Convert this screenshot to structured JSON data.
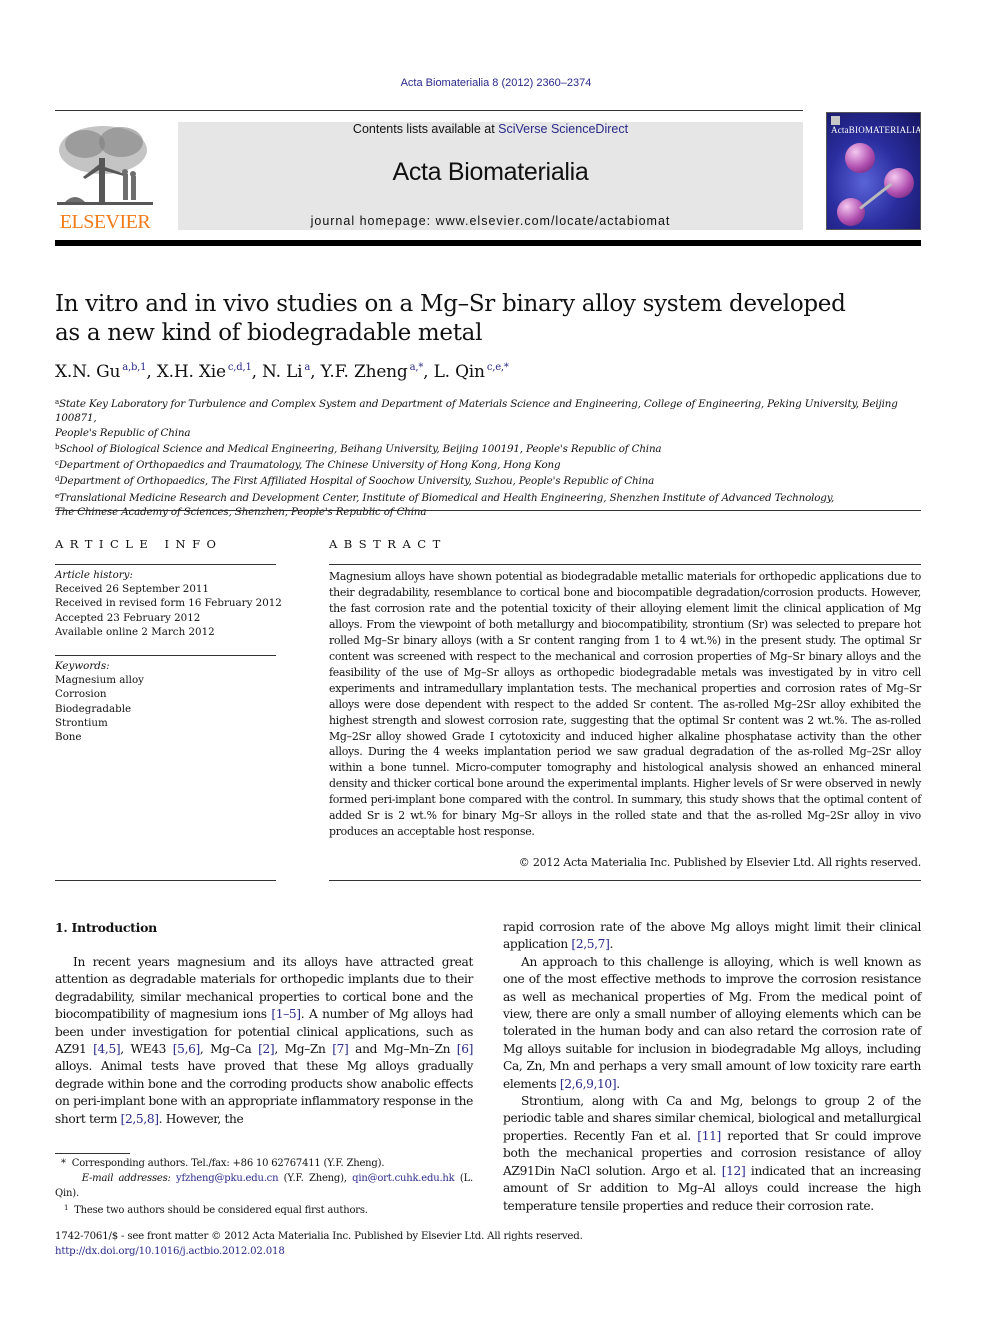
{
  "running_header": "Acta Biomaterialia 8 (2012) 2360–2374",
  "banner": {
    "contents_prefix": "Contents lists available at ",
    "contents_link": "SciVerse ScienceDirect",
    "journal_title": "Acta Biomaterialia",
    "homepage": "journal homepage: www.elsevier.com/locate/actabiomat"
  },
  "publisher_logo": {
    "wordmark": "ELSEVIER",
    "color": "#f07d1a"
  },
  "cover": {
    "title": "ActaBIOMATERIALIA"
  },
  "article": {
    "title_line1": "In vitro and in vivo studies on a Mg–Sr binary alloy system developed",
    "title_line2": "as a new kind of biodegradable metal",
    "authors": [
      {
        "name": "X.N. Gu",
        "sup": "a,b,1",
        "sep": ", "
      },
      {
        "name": "X.H. Xie",
        "sup": "c,d,1",
        "sep": ", "
      },
      {
        "name": "N. Li",
        "sup": "a",
        "sep": ", "
      },
      {
        "name": "Y.F. Zheng",
        "sup": "a,*",
        "sep": ", "
      },
      {
        "name": "L. Qin",
        "sup": "c,e,*",
        "sep": ""
      }
    ],
    "affiliations": [
      {
        "key": "a",
        "line1": "State Key Laboratory for Turbulence and Complex System and Department of Materials Science and Engineering, College of Engineering, Peking University, Beijing 100871,",
        "line2": "People's Republic of China"
      },
      {
        "key": "b",
        "line1": "School of Biological Science and Medical Engineering, Beihang University, Beijing 100191, People's Republic of China",
        "line2": ""
      },
      {
        "key": "c",
        "line1": "Department of Orthopaedics and Traumatology, The Chinese University of Hong Kong, Hong Kong",
        "line2": ""
      },
      {
        "key": "d",
        "line1": "Department of Orthopaedics, The First Affiliated Hospital of Soochow University, Suzhou, People's Republic of China",
        "line2": ""
      },
      {
        "key": "e",
        "line1": "Translational Medicine Research and Development Center, Institute of Biomedical and Health Engineering, Shenzhen Institute of Advanced Technology,",
        "line2": "The Chinese Academy of Sciences, Shenzhen, People's Republic of China"
      }
    ]
  },
  "article_info": {
    "heading": "ARTICLE INFO",
    "history_label": "Article history:",
    "history": [
      "Received 26 September 2011",
      "Received in revised form 16 February 2012",
      "Accepted 23 February 2012",
      "Available online 2 March 2012"
    ],
    "keywords_label": "Keywords:",
    "keywords": [
      "Magnesium alloy",
      "Corrosion",
      "Biodegradable",
      "Strontium",
      "Bone"
    ]
  },
  "abstract": {
    "heading": "ABSTRACT",
    "text": "Magnesium alloys have shown potential as biodegradable metallic materials for orthopedic applications due to their degradability, resemblance to cortical bone and biocompatible degradation/corrosion products. However, the fast corrosion rate and the potential toxicity of their alloying element limit the clinical application of Mg alloys. From the viewpoint of both metallurgy and biocompatibility, strontium (Sr) was selected to prepare hot rolled Mg–Sr binary alloys (with a Sr content ranging from 1 to 4 wt.%) in the present study. The optimal Sr content was screened with respect to the mechanical and corrosion properties of Mg–Sr binary alloys and the feasibility of the use of Mg–Sr alloys as orthopedic biodegradable metals was investigated by in vitro cell experiments and intramedullary implantation tests. The mechanical properties and corrosion rates of Mg–Sr alloys were dose dependent with respect to the added Sr content. The as-rolled Mg–2Sr alloy exhibited the highest strength and slowest corrosion rate, suggesting that the optimal Sr content was 2 wt.%. The as-rolled Mg–2Sr alloy showed Grade I cytotoxicity and induced higher alkaline phosphatase activity than the other alloys. During the 4 weeks implantation period we saw gradual degradation of the as-rolled Mg–2Sr alloy within a bone tunnel. Micro-computer tomography and histological analysis showed an enhanced mineral density and thicker cortical bone around the experimental implants. Higher levels of Sr were observed in newly formed peri-implant bone compared with the control. In summary, this study shows that the optimal content of added Sr is 2 wt.% for binary Mg–Sr alloys in the rolled state and that the as-rolled Mg–2Sr alloy in vivo produces an acceptable host response.",
    "copyright": "© 2012 Acta Materialia Inc. Published by Elsevier Ltd. All rights reserved."
  },
  "introduction": {
    "heading": "1. Introduction",
    "left_paragraph": [
      {
        "t": "In recent years magnesium and its alloys have attracted great attention as degradable materials for orthopedic implants due to their degradability, similar mechanical properties to cortical bone and the biocompatibility of magnesium ions "
      },
      {
        "ref": "[1–5]"
      },
      {
        "t": ". A number of Mg alloys had been under investigation for potential clinical applications, such as AZ91 "
      },
      {
        "ref": "[4,5]"
      },
      {
        "t": ", WE43 "
      },
      {
        "ref": "[5,6]"
      },
      {
        "t": ", Mg–Ca "
      },
      {
        "ref": "[2]"
      },
      {
        "t": ", Mg–Zn "
      },
      {
        "ref": "[7]"
      },
      {
        "t": " and Mg–Mn–Zn "
      },
      {
        "ref": "[6]"
      },
      {
        "t": " alloys. Animal tests have proved that these Mg alloys gradually degrade within bone and the corroding products show anabolic effects on peri-implant bone with an appropriate inflammatory response in the short term "
      },
      {
        "ref": "[2,5,8]"
      },
      {
        "t": ". However, the"
      }
    ],
    "right_paragraphs": [
      {
        "indent": false,
        "parts": [
          {
            "t": "rapid corrosion rate of the above Mg alloys might limit their clinical application "
          },
          {
            "ref": "[2,5,7]"
          },
          {
            "t": "."
          }
        ]
      },
      {
        "indent": true,
        "parts": [
          {
            "t": "An approach to this challenge is alloying, which is well known as one of the most effective methods to improve the corrosion resistance as well as mechanical properties of Mg. From the medical point of view, there are only a small number of alloying elements which can be tolerated in the human body and can also retard the corrosion rate of Mg alloys suitable for inclusion in biodegradable Mg alloys, including Ca, Zn, Mn and perhaps a very small amount of low toxicity rare earth elements "
          },
          {
            "ref": "[2,6,9,10]"
          },
          {
            "t": "."
          }
        ]
      },
      {
        "indent": true,
        "parts": [
          {
            "t": "Strontium, along with Ca and Mg, belongs to group 2 of the periodic table and shares similar chemical, biological and metallurgical properties. Recently Fan et al. "
          },
          {
            "ref": "[11]"
          },
          {
            "t": " reported that Sr could improve both the mechanical properties and corrosion resistance of alloy AZ91Din NaCl solution. Argo et al. "
          },
          {
            "ref": "[12]"
          },
          {
            "t": " indicated that an increasing amount of Sr addition to Mg–Al alloys could increase the high temperature tensile properties and reduce their corrosion rate."
          }
        ]
      }
    ]
  },
  "footnotes": {
    "corresponding": "Corresponding authors. Tel./fax: +86 10 62767411 (Y.F. Zheng).",
    "corresponding_mark": "*",
    "email_label": "E-mail addresses:",
    "email1": "yfzheng@pku.edu.cn",
    "email1_owner": " (Y.F. Zheng), ",
    "email2": "qin@ort.cuhk.edu.hk",
    "email2_owner": " (L. Qin).",
    "equal_mark": "1",
    "equal": "These two authors should be considered equal first authors."
  },
  "bottom": {
    "issn_line": "1742-7061/$ - see front matter © 2012 Acta Materialia Inc. Published by Elsevier Ltd. All rights reserved.",
    "doi": "http://dx.doi.org/10.1016/j.actbio.2012.02.018"
  }
}
